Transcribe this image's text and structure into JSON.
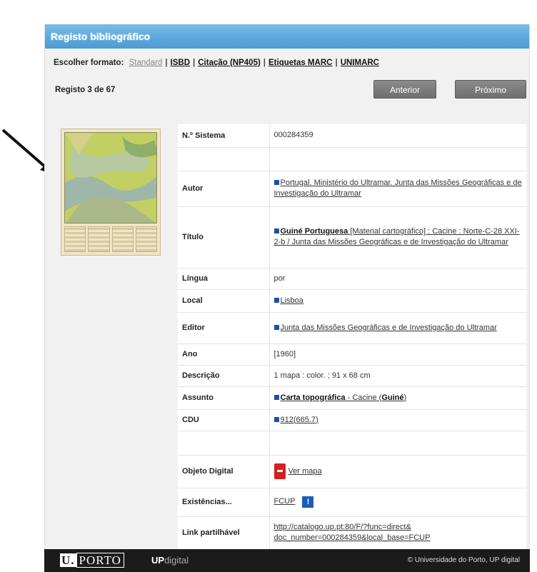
{
  "header": {
    "title": "Registo bibliográfico"
  },
  "formats": {
    "label": "Escolher formato:",
    "items": [
      "Standard",
      "ISBD",
      "Citação (NP405)",
      "Etiquetas MARC",
      "UNIMARC"
    ]
  },
  "record": {
    "count_text": "Registo 3 de 67",
    "prev_label": "Anterior",
    "next_label": "Próximo"
  },
  "fields": {
    "sistema_label": "N.º Sistema",
    "sistema_value": "000284359",
    "autor_label": "Autor",
    "autor_value": "Portugal. Ministério do Ultramar. Junta das Missões Geográficas e de Investigação do Ultramar",
    "titulo_label": "Título",
    "titulo_bold": "Guiné Portuguesa",
    "titulo_rest": "[Material cartográfico] : Cacine : Norte-C-28 XXI-2-b / Junta das Missões Geográficas e de Investigação do Ultramar",
    "lingua_label": "Língua",
    "lingua_value": "por",
    "local_label": "Local",
    "local_value": "Lisboa",
    "editor_label": "Editor",
    "editor_value": "Junta das Missões Geográficas e de Investigação do Ultramar",
    "ano_label": "Ano",
    "ano_value": "[1960]",
    "descricao_label": "Descrição",
    "descricao_value": "1 mapa : color. ; 91 x 68 cm",
    "assunto_label": "Assunto",
    "assunto_bold": "Carta topográfica",
    "assunto_mid": " - Cacine (",
    "assunto_bold2": "Guiné",
    "assunto_end": ")",
    "cdu_label": "CDU",
    "cdu_value": "912(665.7)",
    "objeto_label": "Objeto Digital",
    "objeto_value": "Ver mapa",
    "existencias_label": "Existências...",
    "existencias_value": "FCUP",
    "link_label": "Link partilhável",
    "link_line1": "http://catalogo.up.pt:80/F/?func=direct&",
    "link_line2": "doc_number=000284359&local_base=FCUP"
  },
  "footer": {
    "brand": "PORTO",
    "brand_prefix": "U.",
    "updigital_strong": "UP",
    "updigital_rest": "digital",
    "copyright": "© Universidade do Porto, UP digital"
  },
  "icons": {
    "pdf": "pdf-icon",
    "info": "info-icon",
    "arrow": "arrow-icon"
  },
  "colors": {
    "header_blue": "#5aa6dc",
    "button_gray": "#777777",
    "link_square": "#1f4fa0",
    "pdf_red": "#d42020"
  }
}
